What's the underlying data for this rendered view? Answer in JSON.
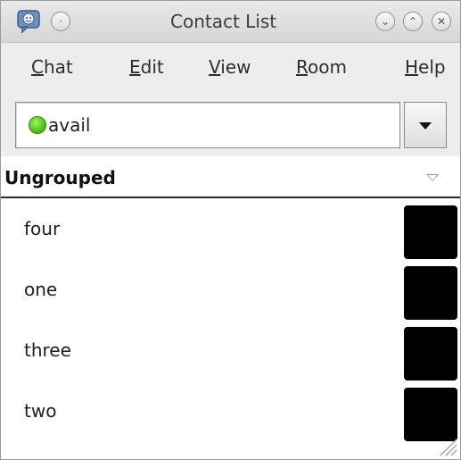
{
  "window": {
    "title": "Contact List"
  },
  "menu": {
    "items": [
      {
        "prefix": "",
        "mnemonic": "C",
        "rest": "hat"
      },
      {
        "prefix": "",
        "mnemonic": "E",
        "rest": "dit"
      },
      {
        "prefix": "",
        "mnemonic": "V",
        "rest": "iew"
      },
      {
        "prefix": "",
        "mnemonic": "R",
        "rest": "oom"
      },
      {
        "prefix": "",
        "mnemonic": "H",
        "rest": "elp"
      }
    ]
  },
  "status": {
    "value": "avail",
    "color": "#4fc218",
    "icon": "available-status-icon"
  },
  "group": {
    "title": "Ungrouped"
  },
  "contacts": [
    {
      "name": "four"
    },
    {
      "name": "one"
    },
    {
      "name": "three"
    },
    {
      "name": "two"
    }
  ],
  "colors": {
    "avatar": "#000000",
    "window_bg": "#ededed"
  }
}
